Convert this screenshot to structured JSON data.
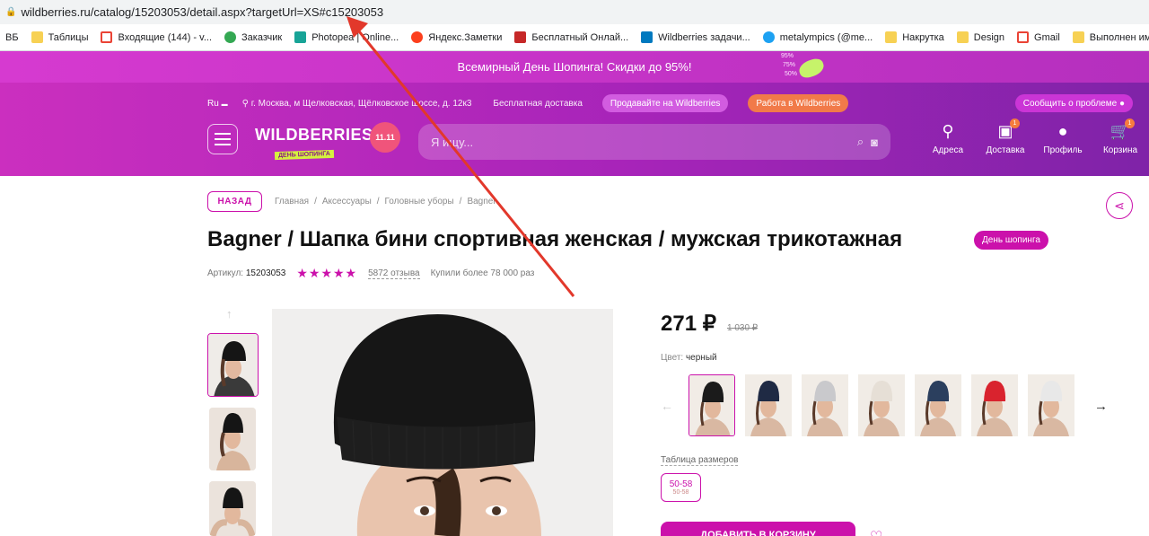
{
  "browser": {
    "url": "wildberries.ru/catalog/15203053/detail.aspx?targetUrl=XS#c15203053",
    "bookmarks": [
      {
        "label": "ВБ",
        "icon": "none",
        "color": ""
      },
      {
        "label": "Таблицы",
        "icon": "folder-icon",
        "color": "#f7d154"
      },
      {
        "label": "Входящие (144) - v...",
        "icon": "gmail-icon",
        "color": "#ea4335"
      },
      {
        "label": "Заказчик",
        "icon": "check-icon",
        "color": "#34a853"
      },
      {
        "label": "Photopea | Online...",
        "icon": "photopea-icon",
        "color": "#18a497"
      },
      {
        "label": "Яндекс.Заметки",
        "icon": "yandex-icon",
        "color": "#fc3f1d"
      },
      {
        "label": "Бесплатный Онлай...",
        "icon": "grid-icon",
        "color": "#c62828"
      },
      {
        "label": "Wildberries задачи...",
        "icon": "trello-icon",
        "color": "#0079bf"
      },
      {
        "label": "metalympics (@me...",
        "icon": "twitter-icon",
        "color": "#1da1f2"
      },
      {
        "label": "Накрутка",
        "icon": "folder-icon",
        "color": "#f7d154"
      },
      {
        "label": "Design",
        "icon": "folder-icon",
        "color": "#f7d154"
      },
      {
        "label": "Gmail",
        "icon": "gmail-icon",
        "color": "#ea4335"
      },
      {
        "label": "Выполнен им",
        "icon": "folder-icon",
        "color": "#f7d154"
      }
    ]
  },
  "promo": {
    "text": "Всемирный День Шопинга! Скидки до 95%!",
    "deco": [
      "95%",
      "75%",
      "50%"
    ]
  },
  "header": {
    "lang": "Ru",
    "address": "г. Москва, м Щелковская, Щёлковское шоссе, д. 12к3",
    "free_delivery": "Бесплатная доставка",
    "sell_button": "Продавайте на Wildberries",
    "work_button": "Работа в Wildberries",
    "report_button": "Сообщить о проблеме",
    "logo_text": "WILDBERRIES",
    "logo_tag": "ДЕНЬ ШОПИНГА",
    "logo_badge": "11.11",
    "search_placeholder": "Я ищу...",
    "nav": [
      {
        "label": "Адреса",
        "icon": "map-pin-icon",
        "count": ""
      },
      {
        "label": "Доставка",
        "icon": "box-icon",
        "count": "1"
      },
      {
        "label": "Профиль",
        "icon": "user-icon",
        "count": ""
      },
      {
        "label": "Корзина",
        "icon": "cart-icon",
        "count": "1"
      }
    ]
  },
  "page": {
    "back_label": "НАЗАД",
    "breadcrumbs": [
      "Главная",
      "Аксессуары",
      "Головные уборы",
      "Bagner"
    ],
    "title": "Bagner / Шапка бини спортивная женская / мужская трикотажная",
    "day_badge": "День шопинга",
    "article_label": "Артикул:",
    "article_value": "15203053",
    "rating_stars": 5,
    "reviews": "5872 отзыва",
    "bought": "Купили более 78 000 раз",
    "price": "271 ₽",
    "old_price": "1 030 ₽",
    "color_label": "Цвет:",
    "color_value": "черный",
    "swatch_colors": [
      "#1b1b1b",
      "#1f2a44",
      "#c9c9cc",
      "#e6dfd6",
      "#2b3f5e",
      "#d9232e",
      "#e8e8e8"
    ],
    "size_table_label": "Таблица размеров",
    "size_main": "50-58",
    "size_sub": "50-58",
    "cart_button": "ДОБАВИТЬ В КОРЗИНУ"
  }
}
